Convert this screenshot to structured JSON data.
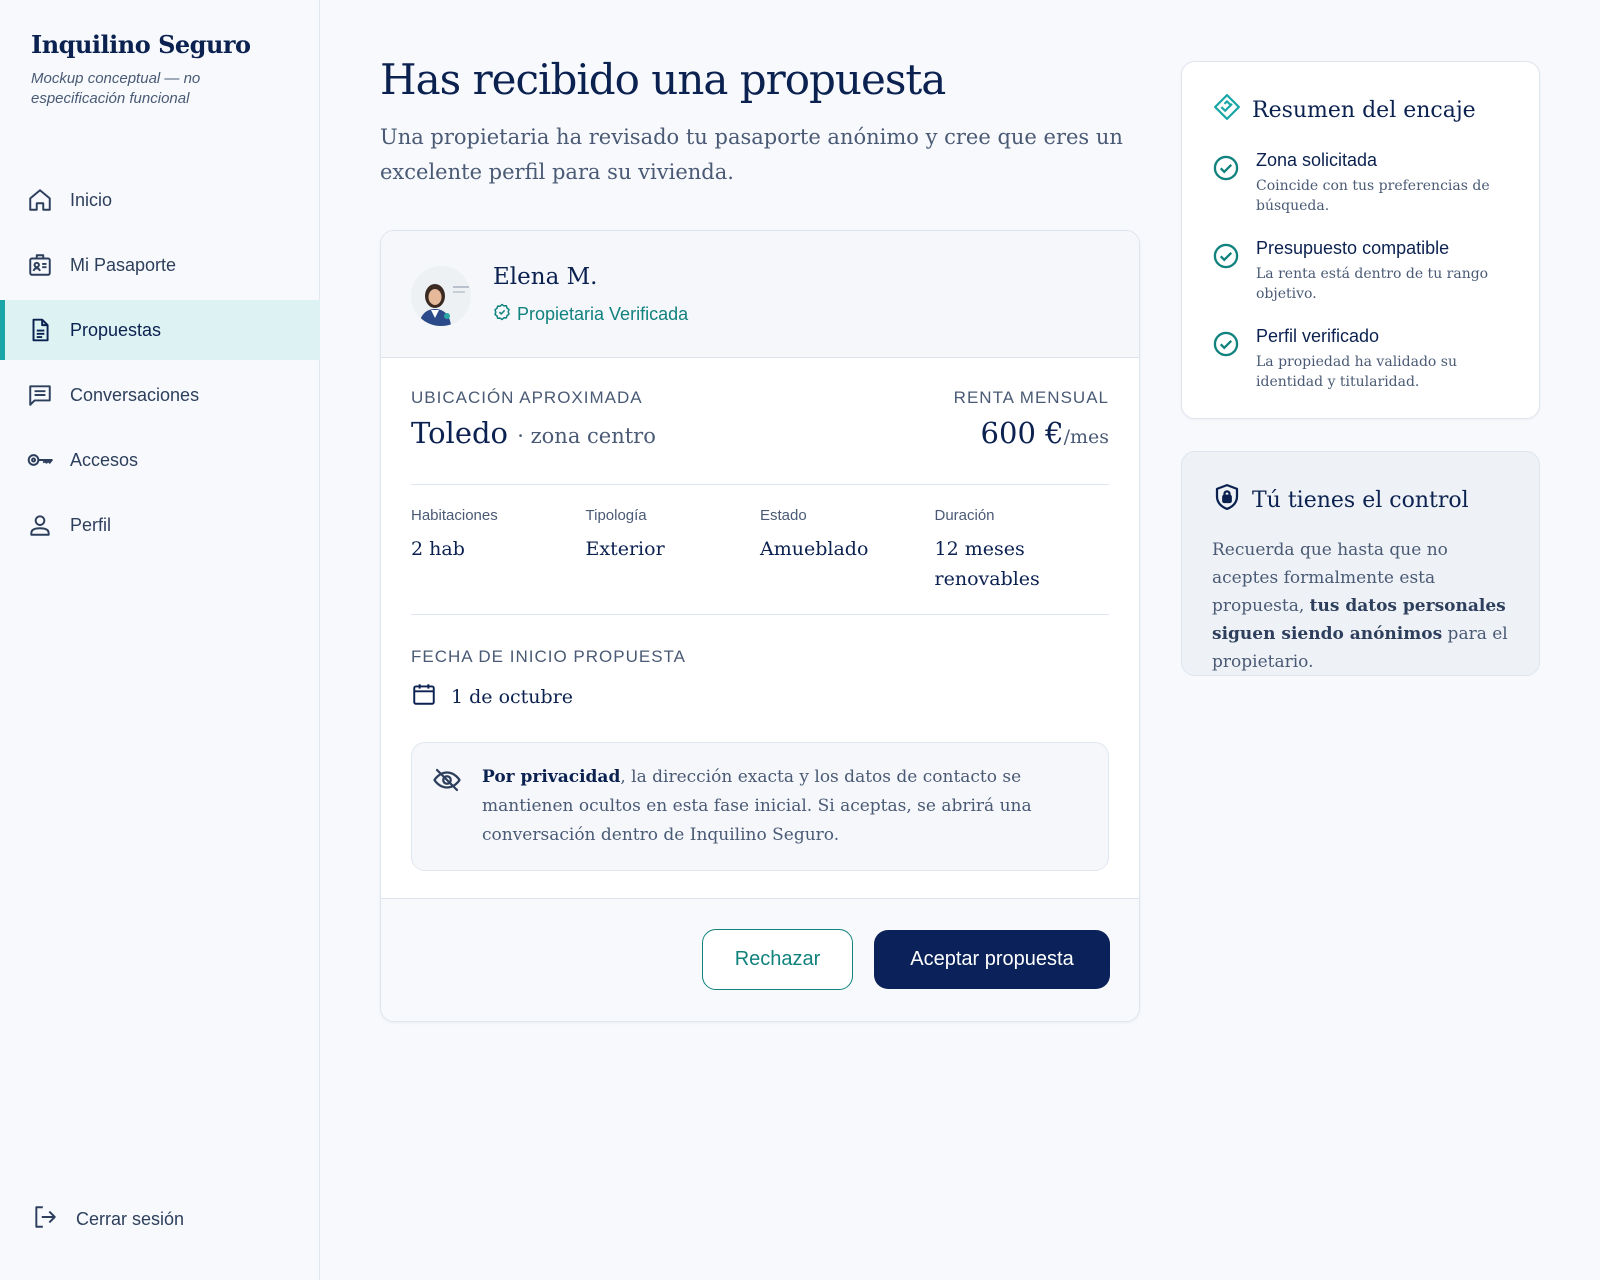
{
  "brand": {
    "title": "Inquilino Seguro",
    "subtitle": "Mockup conceptual — no especificación funcional"
  },
  "nav": {
    "items": [
      {
        "label": "Inicio",
        "icon": "home-icon"
      },
      {
        "label": "Mi Pasaporte",
        "icon": "id-badge-icon"
      },
      {
        "label": "Propuestas",
        "icon": "document-icon",
        "active": true
      },
      {
        "label": "Conversaciones",
        "icon": "chat-icon"
      },
      {
        "label": "Accesos",
        "icon": "key-icon"
      },
      {
        "label": "Perfil",
        "icon": "user-icon"
      }
    ],
    "logout": "Cerrar sesión"
  },
  "main": {
    "title": "Has recibido una propuesta",
    "subtitle": "Una propietaria ha revisado tu pasaporte anónimo y cree que eres un excelente perfil para su vivienda."
  },
  "proposal": {
    "owner_name": "Elena M.",
    "verified_label": "Propietaria Verificada",
    "location_label": "UBICACIÓN APROXIMADA",
    "location_city": "Toledo",
    "location_zone": "· zona centro",
    "rent_label": "RENTA MENSUAL",
    "rent_value": "600 €",
    "rent_period": "/mes",
    "specs": [
      {
        "label": "Habitaciones",
        "value": "2 hab"
      },
      {
        "label": "Tipología",
        "value": "Exterior"
      },
      {
        "label": "Estado",
        "value": "Amueblado"
      },
      {
        "label": "Duración",
        "value": "12 meses renovables"
      }
    ],
    "start_label": "FECHA DE INICIO PROPUESTA",
    "start_value": "1 de octubre",
    "privacy_bold": "Por privacidad",
    "privacy_text": ", la dirección exacta y los datos de contacto se mantienen ocultos en esta fase inicial. Si aceptas, se abrirá una conversación dentro de Inquilino Seguro.",
    "reject_label": "Rechazar",
    "accept_label": "Aceptar propuesta"
  },
  "match": {
    "title": "Resumen del encaje",
    "items": [
      {
        "title": "Zona solicitada",
        "desc": "Coincide con tus preferencias de búsqueda."
      },
      {
        "title": "Presupuesto compatible",
        "desc": "La renta está dentro de tu rango objetivo."
      },
      {
        "title": "Perfil verificado",
        "desc": "La propiedad ha validado su identidad y titularidad."
      }
    ]
  },
  "control": {
    "title": "Tú tienes el control",
    "text_before": "Recuerda que hasta que no aceptes formalmente esta propuesta, ",
    "text_bold": "tus datos personales siguen siendo anónimos",
    "text_after": " para el propietario."
  },
  "colors": {
    "navy": "#0a2259",
    "teal": "#11827e",
    "active_bg": "#ddf3f3"
  }
}
